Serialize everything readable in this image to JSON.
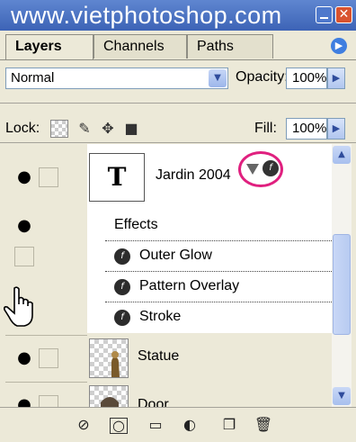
{
  "window": {
    "title": "www.vietphotoshop.com"
  },
  "tabs": [
    {
      "label": "Layers",
      "active": true
    },
    {
      "label": "Channels",
      "active": false
    },
    {
      "label": "Paths",
      "active": false
    }
  ],
  "options": {
    "blend_mode": "Normal",
    "opacity_label": "Opacity:",
    "opacity_value": "100%",
    "lock_label": "Lock:",
    "fill_label": "Fill:",
    "fill_value": "100%"
  },
  "layers": [
    {
      "name": "Jardin 2004",
      "thumb_text": "T",
      "visible": true
    },
    {
      "name": "Statue",
      "visible": true
    },
    {
      "name": "Door",
      "visible": true
    }
  ],
  "effects": {
    "header": "Effects",
    "items": [
      "Outer Glow",
      "Pattern Overlay",
      "Stroke"
    ]
  },
  "colors": {
    "title_bar": "#4a70c2",
    "highlight_circle": "#e0207f",
    "panel_bg": "#ece9d8"
  }
}
